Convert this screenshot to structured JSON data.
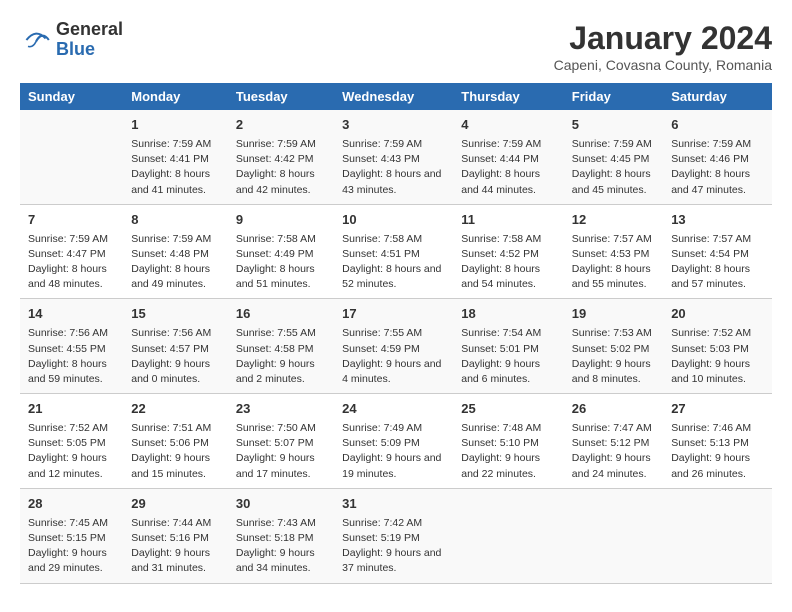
{
  "header": {
    "logo_general": "General",
    "logo_blue": "Blue",
    "title": "January 2024",
    "subtitle": "Capeni, Covasna County, Romania"
  },
  "columns": [
    "Sunday",
    "Monday",
    "Tuesday",
    "Wednesday",
    "Thursday",
    "Friday",
    "Saturday"
  ],
  "weeks": [
    [
      {
        "day": "",
        "sunrise": "",
        "sunset": "",
        "daylight": ""
      },
      {
        "day": "1",
        "sunrise": "Sunrise: 7:59 AM",
        "sunset": "Sunset: 4:41 PM",
        "daylight": "Daylight: 8 hours and 41 minutes."
      },
      {
        "day": "2",
        "sunrise": "Sunrise: 7:59 AM",
        "sunset": "Sunset: 4:42 PM",
        "daylight": "Daylight: 8 hours and 42 minutes."
      },
      {
        "day": "3",
        "sunrise": "Sunrise: 7:59 AM",
        "sunset": "Sunset: 4:43 PM",
        "daylight": "Daylight: 8 hours and 43 minutes."
      },
      {
        "day": "4",
        "sunrise": "Sunrise: 7:59 AM",
        "sunset": "Sunset: 4:44 PM",
        "daylight": "Daylight: 8 hours and 44 minutes."
      },
      {
        "day": "5",
        "sunrise": "Sunrise: 7:59 AM",
        "sunset": "Sunset: 4:45 PM",
        "daylight": "Daylight: 8 hours and 45 minutes."
      },
      {
        "day": "6",
        "sunrise": "Sunrise: 7:59 AM",
        "sunset": "Sunset: 4:46 PM",
        "daylight": "Daylight: 8 hours and 47 minutes."
      }
    ],
    [
      {
        "day": "7",
        "sunrise": "Sunrise: 7:59 AM",
        "sunset": "Sunset: 4:47 PM",
        "daylight": "Daylight: 8 hours and 48 minutes."
      },
      {
        "day": "8",
        "sunrise": "Sunrise: 7:59 AM",
        "sunset": "Sunset: 4:48 PM",
        "daylight": "Daylight: 8 hours and 49 minutes."
      },
      {
        "day": "9",
        "sunrise": "Sunrise: 7:58 AM",
        "sunset": "Sunset: 4:49 PM",
        "daylight": "Daylight: 8 hours and 51 minutes."
      },
      {
        "day": "10",
        "sunrise": "Sunrise: 7:58 AM",
        "sunset": "Sunset: 4:51 PM",
        "daylight": "Daylight: 8 hours and 52 minutes."
      },
      {
        "day": "11",
        "sunrise": "Sunrise: 7:58 AM",
        "sunset": "Sunset: 4:52 PM",
        "daylight": "Daylight: 8 hours and 54 minutes."
      },
      {
        "day": "12",
        "sunrise": "Sunrise: 7:57 AM",
        "sunset": "Sunset: 4:53 PM",
        "daylight": "Daylight: 8 hours and 55 minutes."
      },
      {
        "day": "13",
        "sunrise": "Sunrise: 7:57 AM",
        "sunset": "Sunset: 4:54 PM",
        "daylight": "Daylight: 8 hours and 57 minutes."
      }
    ],
    [
      {
        "day": "14",
        "sunrise": "Sunrise: 7:56 AM",
        "sunset": "Sunset: 4:55 PM",
        "daylight": "Daylight: 8 hours and 59 minutes."
      },
      {
        "day": "15",
        "sunrise": "Sunrise: 7:56 AM",
        "sunset": "Sunset: 4:57 PM",
        "daylight": "Daylight: 9 hours and 0 minutes."
      },
      {
        "day": "16",
        "sunrise": "Sunrise: 7:55 AM",
        "sunset": "Sunset: 4:58 PM",
        "daylight": "Daylight: 9 hours and 2 minutes."
      },
      {
        "day": "17",
        "sunrise": "Sunrise: 7:55 AM",
        "sunset": "Sunset: 4:59 PM",
        "daylight": "Daylight: 9 hours and 4 minutes."
      },
      {
        "day": "18",
        "sunrise": "Sunrise: 7:54 AM",
        "sunset": "Sunset: 5:01 PM",
        "daylight": "Daylight: 9 hours and 6 minutes."
      },
      {
        "day": "19",
        "sunrise": "Sunrise: 7:53 AM",
        "sunset": "Sunset: 5:02 PM",
        "daylight": "Daylight: 9 hours and 8 minutes."
      },
      {
        "day": "20",
        "sunrise": "Sunrise: 7:52 AM",
        "sunset": "Sunset: 5:03 PM",
        "daylight": "Daylight: 9 hours and 10 minutes."
      }
    ],
    [
      {
        "day": "21",
        "sunrise": "Sunrise: 7:52 AM",
        "sunset": "Sunset: 5:05 PM",
        "daylight": "Daylight: 9 hours and 12 minutes."
      },
      {
        "day": "22",
        "sunrise": "Sunrise: 7:51 AM",
        "sunset": "Sunset: 5:06 PM",
        "daylight": "Daylight: 9 hours and 15 minutes."
      },
      {
        "day": "23",
        "sunrise": "Sunrise: 7:50 AM",
        "sunset": "Sunset: 5:07 PM",
        "daylight": "Daylight: 9 hours and 17 minutes."
      },
      {
        "day": "24",
        "sunrise": "Sunrise: 7:49 AM",
        "sunset": "Sunset: 5:09 PM",
        "daylight": "Daylight: 9 hours and 19 minutes."
      },
      {
        "day": "25",
        "sunrise": "Sunrise: 7:48 AM",
        "sunset": "Sunset: 5:10 PM",
        "daylight": "Daylight: 9 hours and 22 minutes."
      },
      {
        "day": "26",
        "sunrise": "Sunrise: 7:47 AM",
        "sunset": "Sunset: 5:12 PM",
        "daylight": "Daylight: 9 hours and 24 minutes."
      },
      {
        "day": "27",
        "sunrise": "Sunrise: 7:46 AM",
        "sunset": "Sunset: 5:13 PM",
        "daylight": "Daylight: 9 hours and 26 minutes."
      }
    ],
    [
      {
        "day": "28",
        "sunrise": "Sunrise: 7:45 AM",
        "sunset": "Sunset: 5:15 PM",
        "daylight": "Daylight: 9 hours and 29 minutes."
      },
      {
        "day": "29",
        "sunrise": "Sunrise: 7:44 AM",
        "sunset": "Sunset: 5:16 PM",
        "daylight": "Daylight: 9 hours and 31 minutes."
      },
      {
        "day": "30",
        "sunrise": "Sunrise: 7:43 AM",
        "sunset": "Sunset: 5:18 PM",
        "daylight": "Daylight: 9 hours and 34 minutes."
      },
      {
        "day": "31",
        "sunrise": "Sunrise: 7:42 AM",
        "sunset": "Sunset: 5:19 PM",
        "daylight": "Daylight: 9 hours and 37 minutes."
      },
      {
        "day": "",
        "sunrise": "",
        "sunset": "",
        "daylight": ""
      },
      {
        "day": "",
        "sunrise": "",
        "sunset": "",
        "daylight": ""
      },
      {
        "day": "",
        "sunrise": "",
        "sunset": "",
        "daylight": ""
      }
    ]
  ]
}
